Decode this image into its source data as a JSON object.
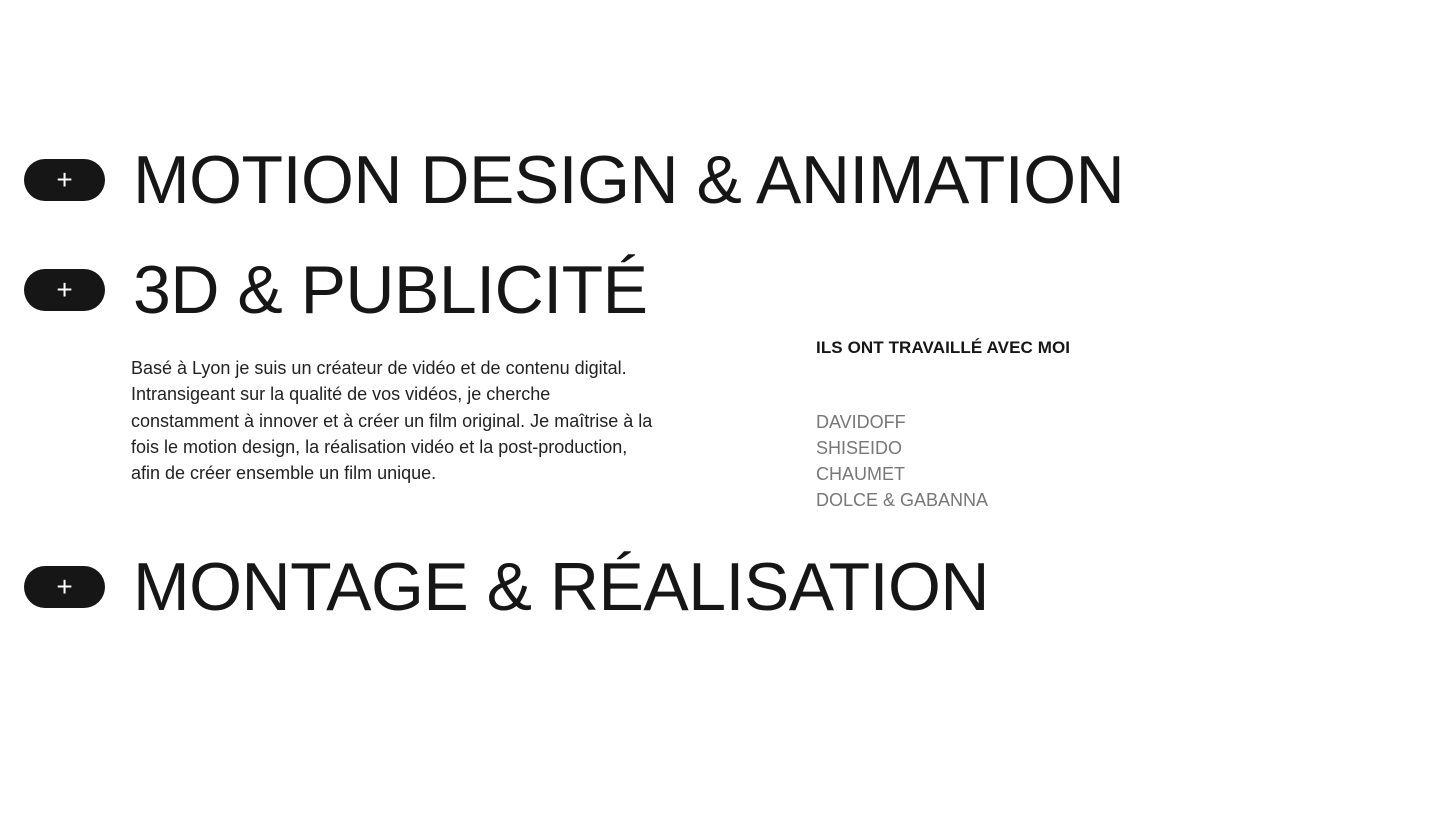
{
  "services": [
    {
      "toggle": "+",
      "title": "MOTION DESIGN & ANIMATION"
    },
    {
      "toggle": "+",
      "title": "3D & PUBLICITÉ"
    },
    {
      "toggle": "+",
      "title": "MONTAGE & RÉALISATION"
    }
  ],
  "bio": "Basé à Lyon je suis un créateur de vidéo et de contenu digital. Intransigeant sur la qualité de vos vidéos, je cherche constamment à innover et à créer un film original. Je maîtrise à la fois le motion design, la réalisation vidéo et la post-production, afin de créer ensemble un film unique.",
  "clients": {
    "title": "ILS ONT TRAVAILLÉ AVEC MOI",
    "items": [
      "DAVIDOFF",
      "SHISEIDO",
      "CHAUMET",
      "DOLCE & GABANNA"
    ]
  }
}
